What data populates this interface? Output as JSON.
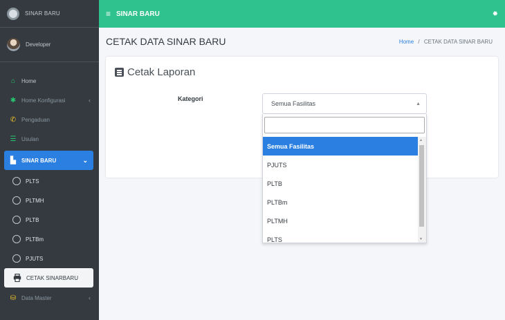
{
  "brand": {
    "text": "SINAR BARU"
  },
  "user": {
    "name": "Developer"
  },
  "sidebar": {
    "items": [
      {
        "label": "Home",
        "icon": "home-icon"
      },
      {
        "label": "Home Konfigurasi",
        "icon": "cogs-icon",
        "arrow": "‹"
      },
      {
        "label": "Pengaduan",
        "icon": "phone-icon"
      },
      {
        "label": "Usulan",
        "icon": "list-icon"
      },
      {
        "label": "SINAR BARU",
        "icon": "building-icon",
        "arrow": "⌄"
      },
      {
        "label": "PLTS"
      },
      {
        "label": "PLTMH"
      },
      {
        "label": "PLTB"
      },
      {
        "label": "PLTBm"
      },
      {
        "label": "PJUTS"
      },
      {
        "label": "CETAK SINARBARU",
        "icon": "print-icon"
      },
      {
        "label": "Data Master",
        "icon": "database-icon",
        "arrow": "‹"
      }
    ]
  },
  "topbar": {
    "menu_icon": "≡",
    "title": "SINAR BARU"
  },
  "header": {
    "title": "CETAK DATA SINAR BARU",
    "breadcrumb_home": "Home",
    "breadcrumb_sep": "/",
    "breadcrumb_current": "CETAK DATA SINAR BARU"
  },
  "card": {
    "title": "Cetak Laporan"
  },
  "form": {
    "kategori_label": "Kategori",
    "selected_value": "Semua Fasilitas"
  },
  "dropdown": {
    "options": [
      "Semua Fasilitas",
      "PJUTS",
      "PLTB",
      "PLTBm",
      "PLTMH",
      "PLTS"
    ]
  },
  "colors": {
    "topbar": "#2fc28e",
    "sidebar": "#343a40",
    "accent": "#2a7fe0"
  }
}
